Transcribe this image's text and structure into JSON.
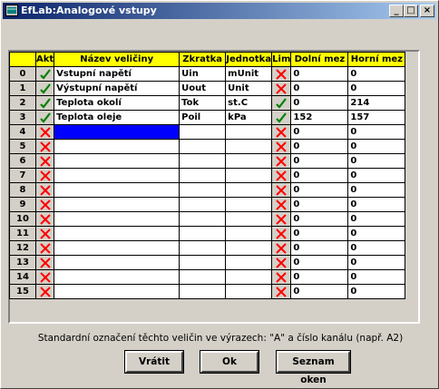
{
  "window": {
    "title": "EfLab:Analogové vstupy"
  },
  "title_buttons": {
    "minimize": "_",
    "maximize": "□",
    "close": "×"
  },
  "table": {
    "headers": [
      "Akt",
      "Název veličiny",
      "Zkratka",
      "Jednotka",
      "Lim",
      "Dolní mez",
      "Horní mez"
    ],
    "rows": [
      {
        "idx": "0",
        "akt": "check",
        "name": "Vstupní napětí",
        "abbr": "Uin",
        "unit": "mUnit",
        "lim": "cross",
        "low": "0",
        "high": "0"
      },
      {
        "idx": "1",
        "akt": "check",
        "name": "Výstupní napětí",
        "abbr": "Uout",
        "unit": "Unit",
        "lim": "cross",
        "low": "0",
        "high": "0"
      },
      {
        "idx": "2",
        "akt": "check",
        "name": "Teplota okolí",
        "abbr": "Tok",
        "unit": "st.C",
        "lim": "check",
        "low": "0",
        "high": "214"
      },
      {
        "idx": "3",
        "akt": "check",
        "name": "Teplota oleje",
        "abbr": "Poil",
        "unit": "kPa",
        "lim": "check",
        "low": "152",
        "high": "157"
      },
      {
        "idx": "4",
        "akt": "cross",
        "name": "",
        "abbr": "",
        "unit": "",
        "lim": "cross",
        "low": "0",
        "high": "0"
      },
      {
        "idx": "5",
        "akt": "cross",
        "name": "",
        "abbr": "",
        "unit": "",
        "lim": "cross",
        "low": "0",
        "high": "0"
      },
      {
        "idx": "6",
        "akt": "cross",
        "name": "",
        "abbr": "",
        "unit": "",
        "lim": "cross",
        "low": "0",
        "high": "0"
      },
      {
        "idx": "7",
        "akt": "cross",
        "name": "",
        "abbr": "",
        "unit": "",
        "lim": "cross",
        "low": "0",
        "high": "0"
      },
      {
        "idx": "8",
        "akt": "cross",
        "name": "",
        "abbr": "",
        "unit": "",
        "lim": "cross",
        "low": "0",
        "high": "0"
      },
      {
        "idx": "9",
        "akt": "cross",
        "name": "",
        "abbr": "",
        "unit": "",
        "lim": "cross",
        "low": "0",
        "high": "0"
      },
      {
        "idx": "10",
        "akt": "cross",
        "name": "",
        "abbr": "",
        "unit": "",
        "lim": "cross",
        "low": "0",
        "high": "0"
      },
      {
        "idx": "11",
        "akt": "cross",
        "name": "",
        "abbr": "",
        "unit": "",
        "lim": "cross",
        "low": "0",
        "high": "0"
      },
      {
        "idx": "12",
        "akt": "cross",
        "name": "",
        "abbr": "",
        "unit": "",
        "lim": "cross",
        "low": "0",
        "high": "0"
      },
      {
        "idx": "13",
        "akt": "cross",
        "name": "",
        "abbr": "",
        "unit": "",
        "lim": "cross",
        "low": "0",
        "high": "0"
      },
      {
        "idx": "14",
        "akt": "cross",
        "name": "",
        "abbr": "",
        "unit": "",
        "lim": "cross",
        "low": "0",
        "high": "0"
      },
      {
        "idx": "15",
        "akt": "cross",
        "name": "",
        "abbr": "",
        "unit": "",
        "lim": "cross",
        "low": "0",
        "high": "0"
      }
    ],
    "selected_row": "4"
  },
  "status": {
    "text": "Standardní označení těchto veličin ve výrazech: \"A\" a číslo kanálu (např. A2)"
  },
  "buttons": {
    "back": "Vrátit",
    "ok": "Ok",
    "window_list": "Seznam oken"
  },
  "colors": {
    "header_bg": "#ffff00",
    "selection": "#0000ff",
    "check": "#008000",
    "cross": "#ff0000",
    "titlebar": "#0a246a"
  }
}
